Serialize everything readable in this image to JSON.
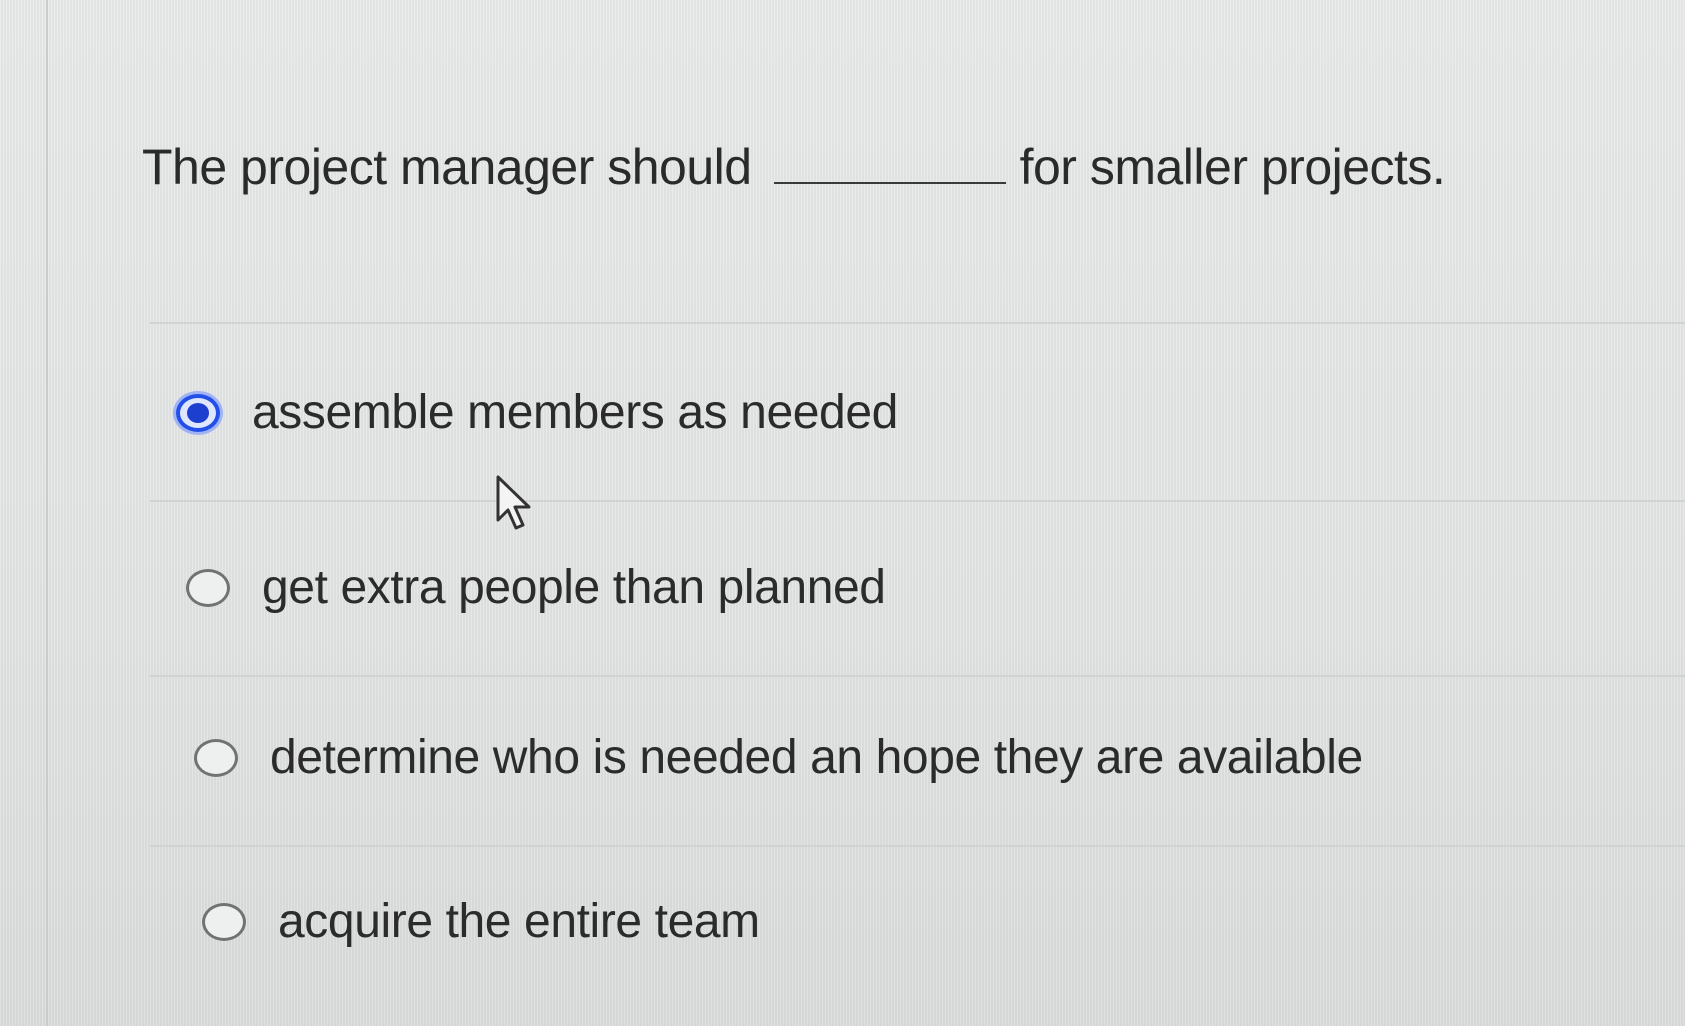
{
  "question": {
    "before_blank": "The project manager should",
    "after_blank": "for smaller projects."
  },
  "options": [
    {
      "label": "assemble members as needed",
      "selected": true
    },
    {
      "label": "get extra people than planned",
      "selected": false
    },
    {
      "label": "determine who is needed an hope they are available",
      "selected": false
    },
    {
      "label": "acquire the entire team",
      "selected": false
    }
  ],
  "colors": {
    "accent": "#1d3fd0",
    "text": "#2b2b2b",
    "background": "#e4e6e6"
  },
  "icons": {
    "pointer": "mouse-pointer-icon"
  }
}
